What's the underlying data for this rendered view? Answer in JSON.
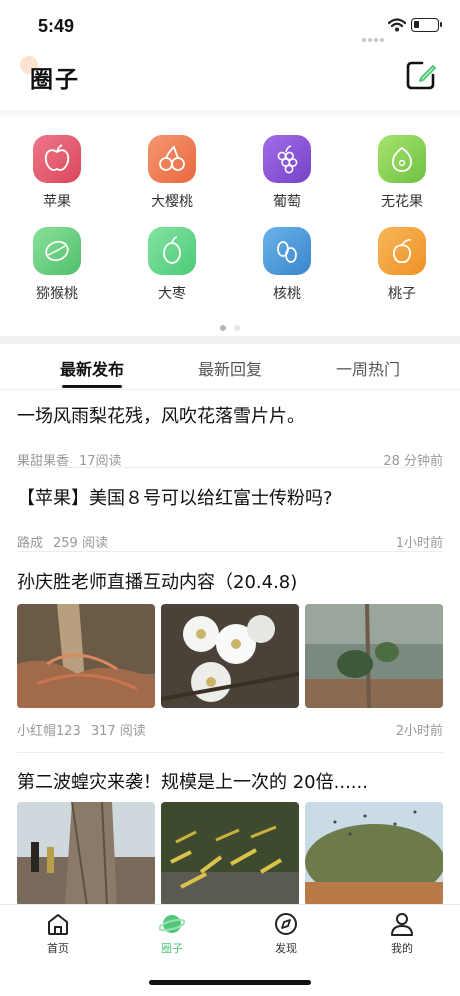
{
  "status_bar": {
    "time": "5:49"
  },
  "header": {
    "title": "圈子"
  },
  "categories": [
    {
      "label": "苹果",
      "icon": "apple-icon",
      "color": "#e45a6b"
    },
    {
      "label": "大樱桃",
      "icon": "cherry-icon",
      "color": "#f07c55"
    },
    {
      "label": "葡萄",
      "icon": "grape-icon",
      "color": "#8a52d6"
    },
    {
      "label": "无花果",
      "icon": "fig-icon",
      "color": "#8bd55a"
    },
    {
      "label": "猕猴桃",
      "icon": "kiwi-icon",
      "color": "#6ed07e"
    },
    {
      "label": "大枣",
      "icon": "jujube-icon",
      "color": "#6ad48a"
    },
    {
      "label": "核桃",
      "icon": "walnut-icon",
      "color": "#4e9bdc"
    },
    {
      "label": "桃子",
      "icon": "peach-icon",
      "color": "#f5a43c"
    }
  ],
  "tabs": [
    "最新发布",
    "最新回复",
    "一周热门"
  ],
  "posts": [
    {
      "title": "一场风雨梨花残，风吹花落雪片片。",
      "author": "果甜果香",
      "reads": "17阅读",
      "time": "28 分钟前"
    },
    {
      "title": "【苹果】美国８号可以给红富士传粉吗?",
      "author": "路成",
      "reads": "259 阅读",
      "time": "1小时前"
    },
    {
      "title": "孙庆胜老师直播互动内容（20.4.8)",
      "author": "小红帽123",
      "reads": "317 阅读",
      "time": "2小时前"
    },
    {
      "title": "第二波蝗灾来袭！规模是上一次的 20倍......"
    }
  ],
  "bottom_nav": [
    {
      "label": "首页",
      "icon": "home-icon"
    },
    {
      "label": "圈子",
      "icon": "circle-planet-icon"
    },
    {
      "label": "发现",
      "icon": "compass-icon"
    },
    {
      "label": "我的",
      "icon": "user-icon"
    }
  ],
  "colors": {
    "accent_green": "#52c87a"
  }
}
